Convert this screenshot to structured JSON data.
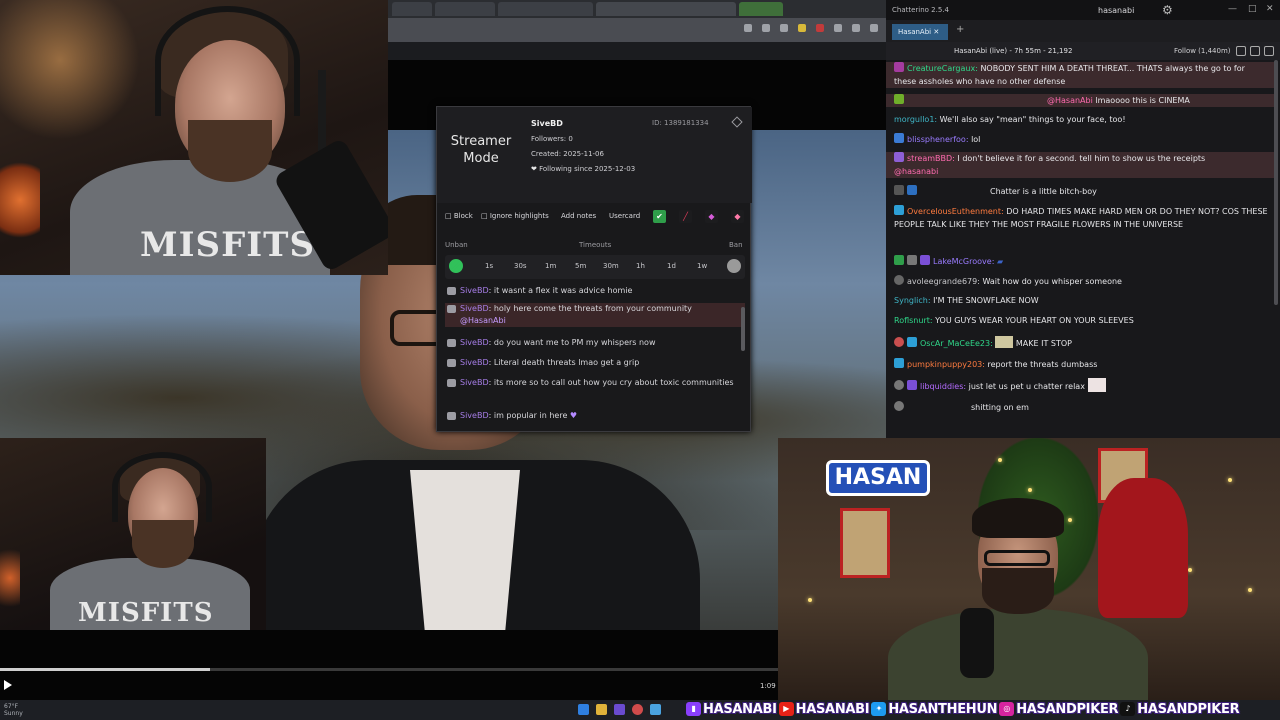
{
  "browser": {
    "tabs": [
      "",
      "",
      "",
      "",
      ""
    ],
    "bookmark_label": ""
  },
  "popup": {
    "mode_label": "Streamer Mode",
    "user": {
      "name": "SiveBD",
      "id_text": "ID: 1389181334",
      "followers": "Followers: 0",
      "created": "Created: 2025-11-06",
      "following": "Following since 2025-12-03"
    },
    "actions": [
      "Block",
      "Ignore highlights",
      "Add notes",
      "Usercard"
    ],
    "timeouts_header": {
      "unban": "Unban",
      "timeouts": "Timeouts",
      "ban": "Ban"
    },
    "timeouts": [
      "1s",
      "30s",
      "1m",
      "5m",
      "30m",
      "1h",
      "1d",
      "1w"
    ],
    "messages": [
      {
        "user": "SiveBD",
        "text": "it wasnt a flex it was advice homie"
      },
      {
        "user": "SiveBD",
        "text": "holy here come the threats from your community",
        "mention": "@HasanAbi",
        "highlight": true
      },
      {
        "user": "SiveBD",
        "text": "do you want me to PM my whispers now"
      },
      {
        "user": "SiveBD",
        "text": "Literal death threats lmao get a grip"
      },
      {
        "user": "SiveBD",
        "text": "its more so to call out how you cry about toxic communities"
      },
      {
        "user": "SiveBD",
        "text": "im popular in here"
      }
    ]
  },
  "chat": {
    "app_title": "Chatterino 2.5.4",
    "account": "hasanabi",
    "tab_label": "HasanAbi",
    "channel_info": "HasanAbi (live) - 7h 55m - 21,192",
    "follow_label": "Follow (1,440m)",
    "lines": [
      {
        "user": "CreatureCargaux:",
        "text": "NOBODY SENT HIM A DEATH THREAT... THATS always the go to for these assholes who have no other defense",
        "color": "u-green",
        "hl": true
      },
      {
        "user": "",
        "text": "@HasanAbi",
        "text2": " lmaoooo this is CINEMA",
        "color": "u-lime",
        "hl": true
      },
      {
        "user": "morgullo1:",
        "text": "We'll also say \"mean\" things to your face, too!",
        "color": "u-teal"
      },
      {
        "user": "blissphenerfoo:",
        "text": "lol",
        "color": "u-violet"
      },
      {
        "user": "streamBBD:",
        "text": "I don't believe it for a second. tell him to show us the receipts",
        "text2": "@hasanabi",
        "color": "u-pink",
        "hl": true
      },
      {
        "user": "",
        "text": "Chatter is a little bitch-boy",
        "color": "u-red"
      },
      {
        "user": "OvercelousEuthenment:",
        "text": "DO HARD TIMES MAKE HARD MEN OR DO THEY NOT? COS THESE PEOPLE TALK LIKE THEY THE MOST FRAGILE FLOWERS IN THE UNIVERSE",
        "color": "u-orange"
      },
      {
        "user": "LakeMcGroove:",
        "text": "",
        "color": "u-violet"
      },
      {
        "user": "avoleegrande679:",
        "text": "Wait how do you whisper someone",
        "color": "u-grey"
      },
      {
        "user": "Synglich:",
        "text": "I'M THE SNOWFLAKE NOW",
        "color": "u-teal"
      },
      {
        "user": "Roflsnurt:",
        "text": "YOU GUYS WEAR YOUR HEART ON YOUR SLEEVES",
        "color": "u-green"
      },
      {
        "user": "OscAr_MaCeEe23:",
        "text": "MAKE IT STOP",
        "color": "u-green"
      },
      {
        "user": "pumpkinpuppy203:",
        "text": "report the threats dumbass",
        "color": "u-orange"
      },
      {
        "user": "libquiddies:",
        "text": "just let us pet u chatter relax",
        "color": "u-purple"
      },
      {
        "user": "",
        "text": "shitting on em",
        "color": "u-red"
      }
    ]
  },
  "cams": {
    "shirt_text": "MISFITS",
    "logo_text": "HASAN"
  },
  "player": {
    "progress_fraction": 0.27,
    "time": "1:09"
  },
  "taskbar": {
    "weather_temp": "67°F",
    "weather_desc": "Sunny"
  },
  "socials": [
    {
      "platform": "twitch-icon",
      "handle": "HASANABI",
      "color": "#8a3ffc"
    },
    {
      "platform": "youtube-icon",
      "handle": "HASANABI",
      "color": "#e62117"
    },
    {
      "platform": "twitter-icon",
      "handle": "HASANTHEHUN",
      "color": "#1d9bf0"
    },
    {
      "platform": "instagram-icon",
      "handle": "HASANDPIKER",
      "color": "#d6249f"
    },
    {
      "platform": "tiktok-icon",
      "handle": "HASANDPIKER",
      "color": "#111111"
    }
  ]
}
